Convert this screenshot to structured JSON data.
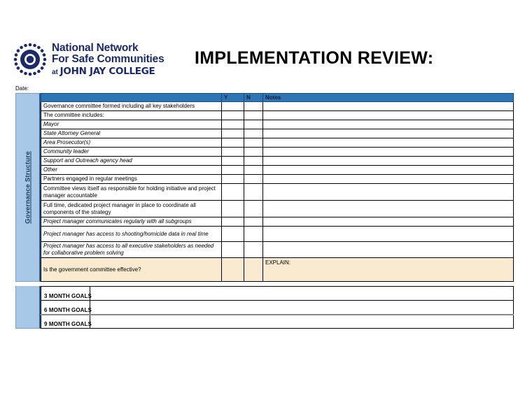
{
  "header": {
    "logo_icon": "nnsc-concentric-dots-logo",
    "org_line1": "National Network",
    "org_line2": "For Safe Communities",
    "org_at": "at ",
    "org_college": "JOHN JAY COLLEGE",
    "title": "IMPLEMENTATION REVIEW:"
  },
  "date_field": {
    "label": "Date:",
    "value": ""
  },
  "section": {
    "vertical_label": "Governance Structure"
  },
  "table": {
    "columns": {
      "item": "",
      "y": "Y",
      "n": "N",
      "notes": "Notes"
    },
    "rows": [
      {
        "item": "Governance committee formed including all key stakeholders",
        "style": "shaded",
        "y": "",
        "n": "",
        "notes": ""
      },
      {
        "item": "The committee includes:",
        "style": "plain",
        "y": "",
        "n": "",
        "notes": ""
      },
      {
        "item": "Mayor",
        "style": "indent-italic",
        "y": "",
        "n": "",
        "notes": ""
      },
      {
        "item": "State Attorney General",
        "style": "indent-italic",
        "y": "",
        "n": "",
        "notes": ""
      },
      {
        "item": "Area Prosecutor(s)",
        "style": "indent-italic",
        "y": "",
        "n": "",
        "notes": ""
      },
      {
        "item": "Community leader",
        "style": "indent-italic",
        "y": "",
        "n": "",
        "notes": ""
      },
      {
        "item": "Support and Outreach agency head",
        "style": "indent-italic",
        "y": "",
        "n": "",
        "notes": ""
      },
      {
        "item": "Other",
        "style": "indent-italic",
        "y": "",
        "n": "",
        "notes": ""
      },
      {
        "item": "Partners engaged in regular meetings",
        "style": "plain",
        "y": "",
        "n": "",
        "notes": ""
      },
      {
        "item": "Committee views itself as responsible for holding initiative and project manager accountable",
        "style": "plain-tall",
        "y": "",
        "n": "",
        "notes": ""
      },
      {
        "item": "Full time, dedicated project manager in place to coordinate all components of the strategy",
        "style": "plain-tall",
        "y": "",
        "n": "",
        "notes": ""
      },
      {
        "item": "Project manager communicates regularly with all subgroups",
        "style": "indent-italic",
        "y": "",
        "n": "",
        "notes": ""
      },
      {
        "item": "Project manager has access to shooting/homicide data in real time",
        "style": "indent-italic-tall",
        "y": "",
        "n": "",
        "notes": ""
      },
      {
        "item": "Project manager has access to all executive stakeholders as needed for collaborative problem solving",
        "style": "indent-italic-tall",
        "y": "",
        "n": "",
        "notes": ""
      },
      {
        "item": "Is the government committee effective?",
        "style": "highlight",
        "y": "",
        "n": "",
        "notes": "EXPLAIN:"
      }
    ]
  },
  "goals": [
    {
      "label": "3 MONTH GOALS",
      "value": ""
    },
    {
      "label": "6 MONTH GOALS",
      "value": ""
    },
    {
      "label": "9 MONTH GOALS",
      "value": ""
    }
  ],
  "colors": {
    "header_blue": "#2e75b6",
    "sidebar_blue": "#a8c8e8",
    "highlight_cream": "#faebd0",
    "shaded_gray": "#e8e8e8",
    "brand_navy": "#1b2a6b"
  }
}
